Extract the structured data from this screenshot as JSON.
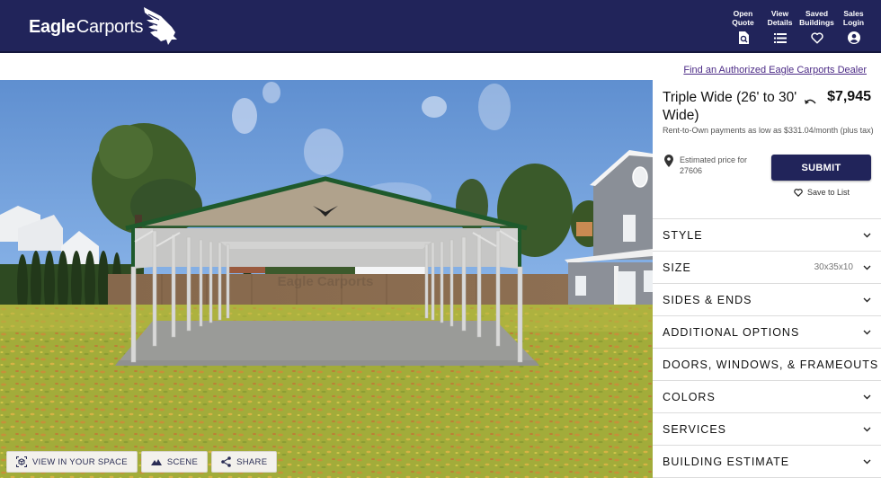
{
  "header": {
    "brand_bold": "Eagle",
    "brand_regular": "Carports",
    "nav": [
      {
        "label": "Open\nQuote",
        "line1": "Open",
        "line2": "Quote",
        "icon": "quote-search-icon"
      },
      {
        "label": "View Details",
        "line1": "View",
        "line2": "Details",
        "icon": "list-icon"
      },
      {
        "label": "Saved Buildings",
        "line1": "Saved",
        "line2": "Buildings",
        "icon": "heart-icon"
      },
      {
        "label": "Sales Login",
        "line1": "Sales",
        "line2": "Login",
        "icon": "account-icon"
      }
    ]
  },
  "dealer_link": "Find an Authorized Eagle Carports Dealer",
  "scene": {
    "watermark": "Eagle Carports",
    "buttons": [
      {
        "label": "VIEW IN YOUR SPACE",
        "icon": "ar-cube-icon"
      },
      {
        "label": "SCENE",
        "icon": "mountain-icon"
      },
      {
        "label": "SHARE",
        "icon": "share-icon"
      }
    ]
  },
  "product": {
    "title": "Triple Wide (26' to 30' Wide)",
    "price": "$7,945",
    "rent_to_own": "Rent-to-Own payments as low as $331.04/month (plus tax)",
    "estimated_price_label": "Estimated price for 27606",
    "submit_label": "SUBMIT",
    "save_label": "Save to List"
  },
  "accordion": [
    {
      "name": "STYLE",
      "value": ""
    },
    {
      "name": "SIZE",
      "value": "30x35x10"
    },
    {
      "name": "SIDES & ENDS",
      "value": ""
    },
    {
      "name": "ADDITIONAL OPTIONS",
      "value": ""
    },
    {
      "name": "DOORS, WINDOWS, & FRAMEOUTS",
      "value": ""
    },
    {
      "name": "COLORS",
      "value": ""
    },
    {
      "name": "SERVICES",
      "value": ""
    },
    {
      "name": "BUILDING ESTIMATE",
      "value": ""
    }
  ],
  "colors": {
    "brand_navy": "#21245a",
    "roof_trim_green": "#1f5a2c",
    "gable_tan": "#b0a28c",
    "link_purple": "#4b2a86"
  }
}
